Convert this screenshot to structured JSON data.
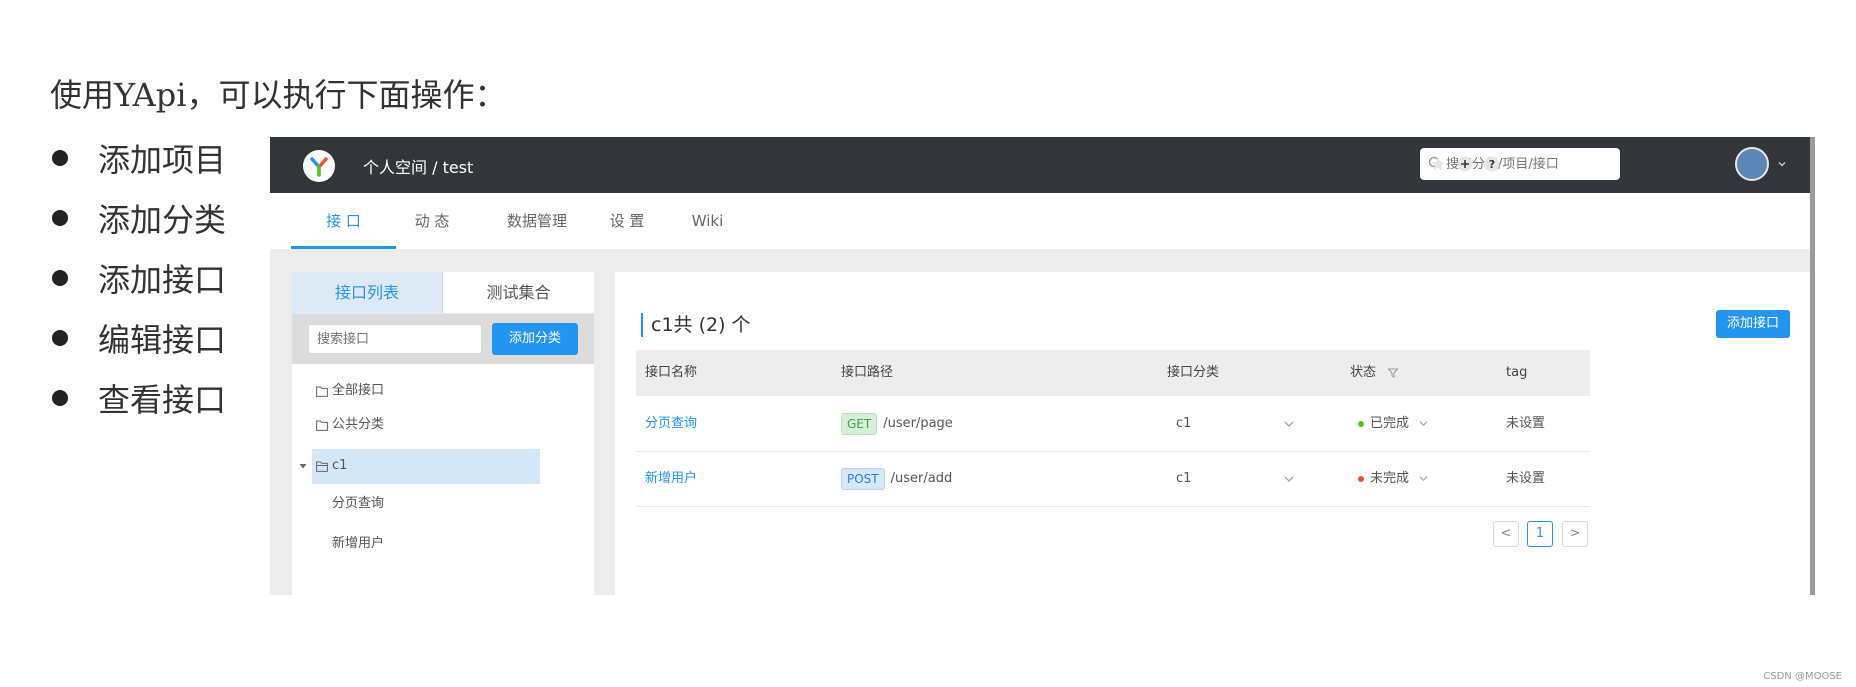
{
  "intro": "使用YApi，可以执行下面操作：",
  "bullets": [
    "添加项目",
    "添加分类",
    "添加接口",
    "编辑接口",
    "查看接口"
  ],
  "app": {
    "breadcrumb": "个人空间 / test",
    "search_placeholder": "搜索分组/项目/接口",
    "accent_color": "#2395f1",
    "topbar_color": "#32363a",
    "icons": [
      "star-icon",
      "plus-circle-icon",
      "help-icon",
      "avatar",
      "chevron-down-icon"
    ]
  },
  "nav": {
    "tabs": [
      "接 口",
      "动 态",
      "数据管理",
      "设 置",
      "Wiki"
    ],
    "active_tab": "接 口"
  },
  "sidebar": {
    "tabs": [
      "接口列表",
      "测试集合"
    ],
    "search_placeholder": "搜索接口",
    "add_category": "添加分类",
    "tree": {
      "all": "全部接口",
      "public": "公共分类",
      "category": "c1",
      "children": [
        "分页查询",
        "新增用户"
      ]
    }
  },
  "main": {
    "title": "c1共 (2) 个",
    "add_button": "添加接口",
    "columns": [
      "接口名称",
      "接口路径",
      "接口分类",
      "状态",
      "tag"
    ],
    "rows": [
      {
        "name": "分页查询",
        "method": "GET",
        "path": "/user/page",
        "category": "c1",
        "status": "已完成",
        "status_color": "#52c41a",
        "tag": "未设置"
      },
      {
        "name": "新增用户",
        "method": "POST",
        "path": "/user/add",
        "category": "c1",
        "status": "未完成",
        "status_color": "#f5502d",
        "tag": "未设置"
      }
    ],
    "pagination": {
      "current": "1",
      "prev": "<",
      "next": ">"
    }
  },
  "watermark": "CSDN @MOOSE"
}
